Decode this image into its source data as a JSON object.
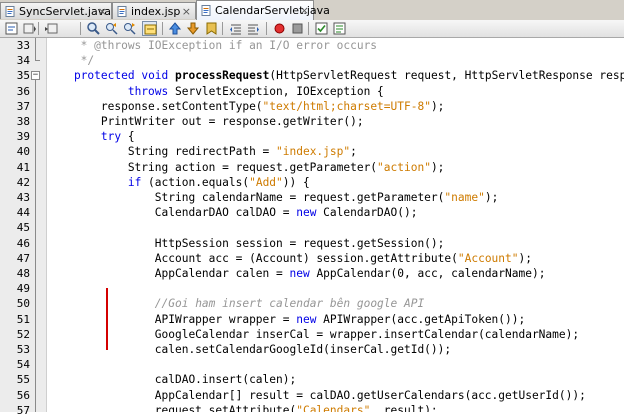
{
  "tabs": [
    {
      "label": "SyncServlet.java",
      "icon": "java-file-icon",
      "active": false
    },
    {
      "label": "index.jsp",
      "icon": "jsp-file-icon",
      "active": false
    },
    {
      "label": "CalendarServlet.java",
      "icon": "java-file-icon",
      "active": true
    }
  ],
  "tab_close_glyph": "×",
  "toolbar": {
    "icons": [
      "source-view-icon",
      "back-icon",
      "forward-icon",
      "find-icon",
      "find-previous-icon",
      "find-next-icon",
      "toggle-highlight-icon",
      "previous-bookmark-icon",
      "next-bookmark-icon",
      "toggle-bookmark-icon",
      "shift-left-icon",
      "shift-right-icon",
      "start-macro-icon",
      "stop-macro-icon",
      "check-icon",
      "uncomment-icon"
    ]
  },
  "colors": {
    "keyword": "#0000e6",
    "string": "#ce7b00",
    "comment": "#969696",
    "mark": "#d40000"
  },
  "lines": [
    {
      "n": "33",
      "segs": [
        [
          "     * @throws IOException if an I/O error occurs",
          "cm"
        ]
      ]
    },
    {
      "n": "34",
      "segs": [
        [
          "     */",
          "cm"
        ]
      ]
    },
    {
      "n": "35",
      "segs": [
        [
          "    ",
          ""
        ],
        [
          "protected",
          "kw"
        ],
        [
          " ",
          ""
        ],
        [
          "void",
          "kw"
        ],
        [
          " ",
          ""
        ],
        [
          "processRequest",
          "b"
        ],
        [
          "(HttpServletRequest request, HttpServletResponse resp",
          ""
        ]
      ]
    },
    {
      "n": "36",
      "segs": [
        [
          "            ",
          ""
        ],
        [
          "throws",
          "kw"
        ],
        [
          " ServletException, IOException {",
          ""
        ]
      ]
    },
    {
      "n": "37",
      "segs": [
        [
          "        response.setContentType(",
          ""
        ],
        [
          "\"text/html;charset=UTF-8\"",
          "str"
        ],
        [
          ");",
          ""
        ]
      ]
    },
    {
      "n": "38",
      "segs": [
        [
          "        PrintWriter out = response.getWriter();",
          ""
        ]
      ]
    },
    {
      "n": "39",
      "segs": [
        [
          "        ",
          ""
        ],
        [
          "try",
          "kw"
        ],
        [
          " {",
          ""
        ]
      ]
    },
    {
      "n": "40",
      "segs": [
        [
          "            String redirectPath = ",
          ""
        ],
        [
          "\"index.jsp\"",
          "str"
        ],
        [
          ";",
          ""
        ]
      ]
    },
    {
      "n": "41",
      "segs": [
        [
          "            String action = request.getParameter(",
          ""
        ],
        [
          "\"action\"",
          "str"
        ],
        [
          ");",
          ""
        ]
      ]
    },
    {
      "n": "42",
      "segs": [
        [
          "            ",
          ""
        ],
        [
          "if",
          "kw"
        ],
        [
          " (action.equals(",
          ""
        ],
        [
          "\"Add\"",
          "str"
        ],
        [
          ")) {",
          ""
        ]
      ]
    },
    {
      "n": "43",
      "segs": [
        [
          "                String calendarName = request.getParameter(",
          ""
        ],
        [
          "\"name\"",
          "str"
        ],
        [
          ");",
          ""
        ]
      ]
    },
    {
      "n": "44",
      "segs": [
        [
          "                CalendarDAO calDAO = ",
          ""
        ],
        [
          "new",
          "kw"
        ],
        [
          " CalendarDAO();",
          ""
        ]
      ]
    },
    {
      "n": "45",
      "segs": [
        [
          "",
          ""
        ]
      ]
    },
    {
      "n": "46",
      "segs": [
        [
          "                HttpSession session = request.getSession();",
          ""
        ]
      ]
    },
    {
      "n": "47",
      "segs": [
        [
          "                Account acc = (Account) session.getAttribute(",
          ""
        ],
        [
          "\"Account\"",
          "str"
        ],
        [
          ");",
          ""
        ]
      ]
    },
    {
      "n": "48",
      "segs": [
        [
          "                AppCalendar calen = ",
          ""
        ],
        [
          "new",
          "kw"
        ],
        [
          " AppCalendar(0, acc, calendarName);",
          ""
        ]
      ]
    },
    {
      "n": "49",
      "segs": [
        [
          "",
          ""
        ]
      ]
    },
    {
      "n": "50",
      "segs": [
        [
          "                ",
          ""
        ],
        [
          "//Goi ham insert calendar bên google API",
          "cmi"
        ]
      ]
    },
    {
      "n": "51",
      "segs": [
        [
          "                APIWrapper wrapper = ",
          ""
        ],
        [
          "new",
          "kw"
        ],
        [
          " APIWrapper(acc.getApiToken());",
          ""
        ]
      ]
    },
    {
      "n": "52",
      "segs": [
        [
          "                GoogleCalendar inserCal = wrapper.insertCalendar(calendarName);",
          ""
        ]
      ]
    },
    {
      "n": "53",
      "segs": [
        [
          "                calen.setCalendarGoogleId(inserCal.getId());",
          ""
        ]
      ]
    },
    {
      "n": "54",
      "segs": [
        [
          "",
          ""
        ]
      ]
    },
    {
      "n": "55",
      "segs": [
        [
          "                calDAO.insert(calen);",
          ""
        ]
      ]
    },
    {
      "n": "56",
      "segs": [
        [
          "                AppCalendar[] result = calDAO.getUserCalendars(acc.getUserId());",
          ""
        ]
      ]
    },
    {
      "n": "57",
      "segs": [
        [
          "                request.setAttribute(",
          ""
        ],
        [
          "\"Calendars\"",
          "str"
        ],
        [
          ", result);",
          ""
        ]
      ]
    }
  ],
  "fold_markers": [
    {
      "line": "35",
      "glyph": "−"
    }
  ]
}
